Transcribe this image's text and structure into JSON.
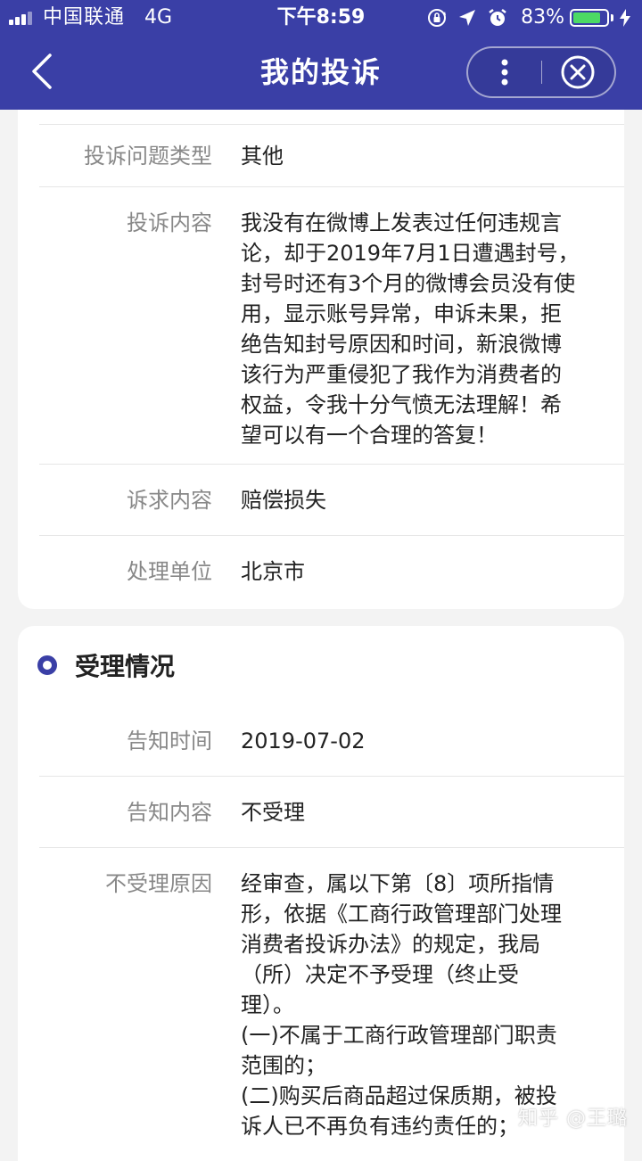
{
  "status_bar": {
    "carrier": "中国联通",
    "network": "4G",
    "time": "下午8:59",
    "battery_percent": "83%",
    "battery_level": 0.83,
    "icons": [
      "rotation-lock-icon",
      "location-icon",
      "alarm-icon",
      "charging-icon"
    ]
  },
  "nav": {
    "title": "我的投诉",
    "back_icon": "chevron-left-icon",
    "more_icon": "more-vertical-icon",
    "close_icon": "close-circle-icon"
  },
  "complaint": {
    "rows": [
      {
        "label": "投诉问题类型",
        "value": "其他"
      },
      {
        "label": "投诉内容",
        "value": "我没有在微博上发表过任何违规言\n论，却于2019年7月1日遭遇封号，\n封号时还有3个月的微博会员没有使\n用，显示账号异常，申诉未果，拒\n绝告知封号原因和时间，新浪微博\n该行为严重侵犯了我作为消费者的\n权益，令我十分气愤无法理解！希\n望可以有一个合理的答复！"
      },
      {
        "label": "诉求内容",
        "value": "赔偿损失"
      },
      {
        "label": "处理单位",
        "value": "北京市"
      }
    ]
  },
  "acceptance": {
    "title": "受理情况",
    "rows": [
      {
        "label": "告知时间",
        "value": "2019-07-02"
      },
      {
        "label": "告知内容",
        "value": "不受理"
      },
      {
        "label": "不受理原因",
        "value": "经审查，属以下第〔8〕项所指情\n形，依据《工商行政管理部门处理\n消费者投诉办法》的规定，我局\n（所）决定不予受理（终止受\n理）。\n(一)不属于工商行政管理部门职责\n范围的；\n(二)购买后商品超过保质期，被投\n诉人已不再负有违约责任的；"
      }
    ]
  },
  "watermark": "知乎 @王璐",
  "colors": {
    "header_bg": "#3a3fa6",
    "page_bg": "#f3f3f3",
    "card_bg": "#ffffff",
    "label": "#888888",
    "value": "#222222",
    "accent": "#3a3fa6",
    "battery": "#4cd964"
  }
}
